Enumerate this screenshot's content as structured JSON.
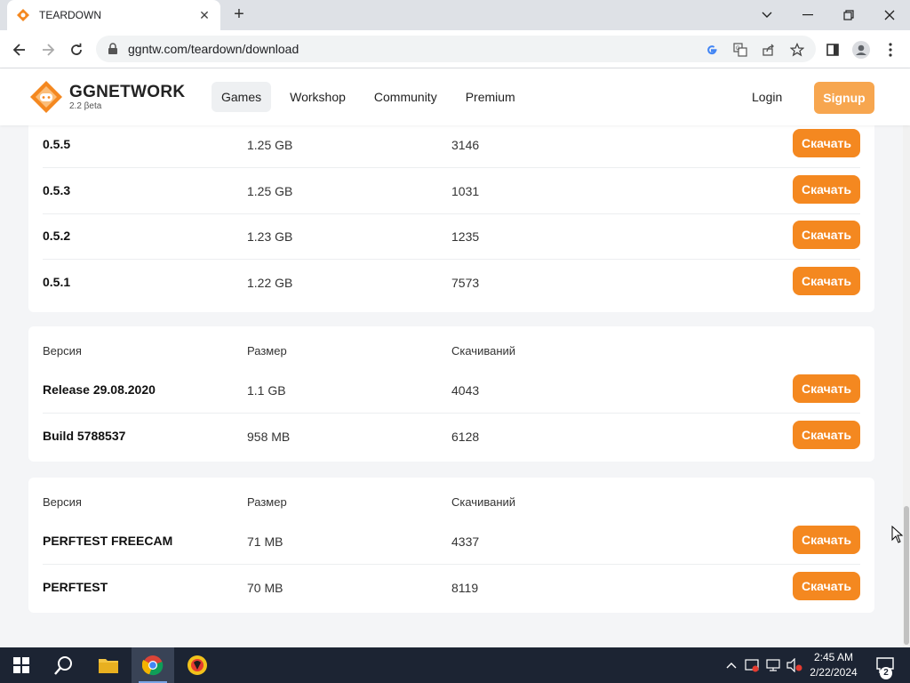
{
  "browser": {
    "tab_title": "TEARDOWN",
    "url": "ggntw.com/teardown/download"
  },
  "site": {
    "logo_name": "GGNETWORK",
    "logo_version": "2.2 βeta",
    "nav": [
      "Games",
      "Workshop",
      "Community",
      "Premium"
    ],
    "login_label": "Login",
    "signup_label": "Signup",
    "accent_color": "#f48820"
  },
  "tables": [
    {
      "headers": null,
      "rows": [
        {
          "version": "0.5.5",
          "size": "1.25 GB",
          "downloads": "3146",
          "button": "Скачать"
        },
        {
          "version": "0.5.3",
          "size": "1.25 GB",
          "downloads": "1031",
          "button": "Скачать"
        },
        {
          "version": "0.5.2",
          "size": "1.23 GB",
          "downloads": "1235",
          "button": "Скачать"
        },
        {
          "version": "0.5.1",
          "size": "1.22 GB",
          "downloads": "7573",
          "button": "Скачать"
        }
      ]
    },
    {
      "headers": [
        "Версия",
        "Размер",
        "Скачиваний"
      ],
      "rows": [
        {
          "version": "Release 29.08.2020",
          "size": "1.1 GB",
          "downloads": "4043",
          "button": "Скачать"
        },
        {
          "version": "Build 5788537",
          "size": "958 MB",
          "downloads": "6128",
          "button": "Скачать"
        }
      ]
    },
    {
      "headers": [
        "Версия",
        "Размер",
        "Скачиваний"
      ],
      "rows": [
        {
          "version": "PERFTEST FREECAM",
          "size": "71 MB",
          "downloads": "4337",
          "button": "Скачать"
        },
        {
          "version": "PERFTEST",
          "size": "70 MB",
          "downloads": "8119",
          "button": "Скачать"
        }
      ]
    }
  ],
  "taskbar": {
    "time": "2:45 AM",
    "date": "2/22/2024",
    "notification_count": "2"
  }
}
